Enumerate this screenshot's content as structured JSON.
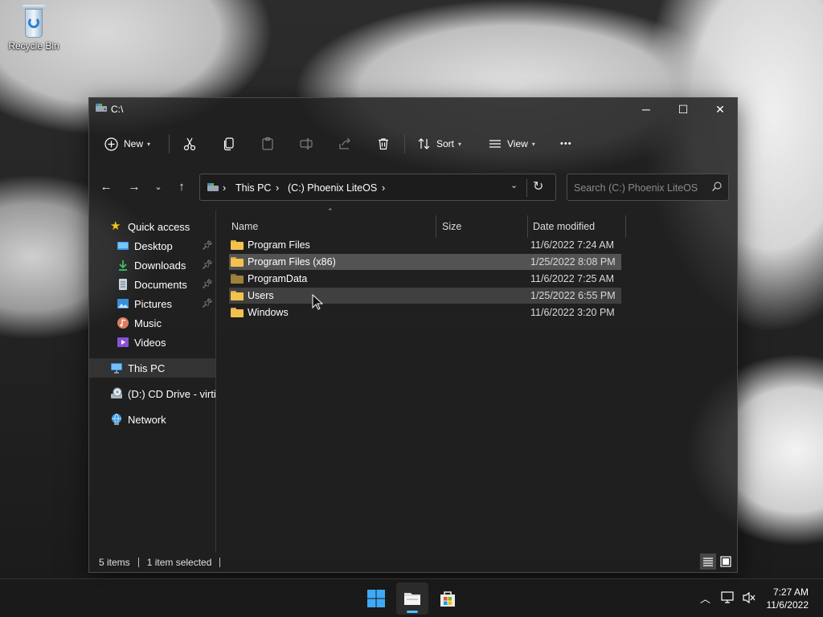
{
  "desktop": {
    "recycle_bin_label": "Recycle Bin"
  },
  "window": {
    "title": "C:\\",
    "controls": {
      "minimize": "─",
      "maximize": "☐",
      "close": "✕"
    }
  },
  "command_bar": {
    "new_label": "New",
    "sort_label": "Sort",
    "view_label": "View",
    "more_label": "•••"
  },
  "address_bar": {
    "crumbs": [
      "This PC",
      "(C:) Phoenix LiteOS"
    ],
    "separator": "›"
  },
  "search": {
    "placeholder": "Search (C:) Phoenix LiteOS"
  },
  "sidebar": {
    "quick_access": "Quick access",
    "items": [
      {
        "label": "Desktop",
        "pinned": true
      },
      {
        "label": "Downloads",
        "pinned": true
      },
      {
        "label": "Documents",
        "pinned": true
      },
      {
        "label": "Pictures",
        "pinned": true
      },
      {
        "label": "Music",
        "pinned": false
      },
      {
        "label": "Videos",
        "pinned": false
      }
    ],
    "this_pc": "This PC",
    "cd_drive": "(D:) CD Drive - virtio-win",
    "network": "Network"
  },
  "columns": {
    "name": "Name",
    "size": "Size",
    "date_modified": "Date modified"
  },
  "files": [
    {
      "name": "Program Files",
      "date": "11/6/2022 7:24 AM"
    },
    {
      "name": "Program Files (x86)",
      "date": "1/25/2022 8:08 PM"
    },
    {
      "name": "ProgramData",
      "date": "11/6/2022 7:25 AM"
    },
    {
      "name": "Users",
      "date": "1/25/2022 6:55 PM"
    },
    {
      "name": "Windows",
      "date": "11/6/2022 3:20 PM"
    }
  ],
  "status_bar": {
    "item_count": "5 items",
    "selection": "1 item selected"
  },
  "taskbar": {
    "time": "7:27 AM",
    "date": "11/6/2022"
  },
  "colors": {
    "accent": "#4cc2ff",
    "folder": "#f2c14e",
    "window_bg": "#202020"
  }
}
